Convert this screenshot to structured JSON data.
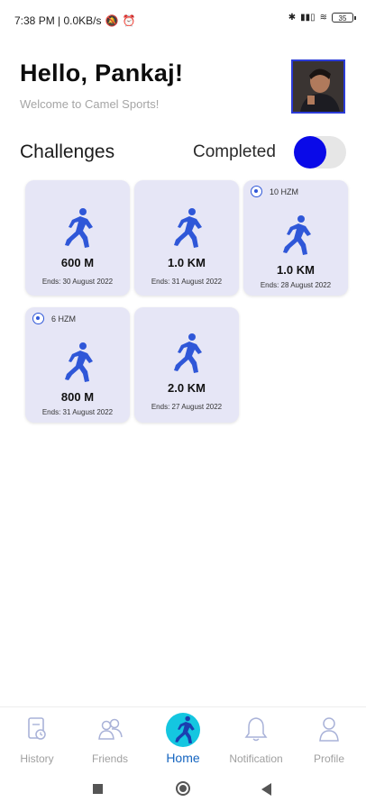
{
  "status_bar": {
    "time_net": "7:38 PM | 0.0KB/s",
    "battery": "35"
  },
  "header": {
    "greeting": "Hello, Pankaj!",
    "welcome": "Welcome to Camel Sports!"
  },
  "challenges": {
    "title": "Challenges",
    "completed_label": "Completed",
    "completed_toggle_on": false,
    "cards": [
      {
        "badge": "",
        "distance": "600 M",
        "ends": "Ends: 30 August 2022"
      },
      {
        "badge": "",
        "distance": "1.0 KM",
        "ends": "Ends: 31 August 2022"
      },
      {
        "badge": "10 HZM",
        "distance": "1.0 KM",
        "ends": "Ends: 28 August 2022"
      },
      {
        "badge": "6 HZM",
        "distance": "800 M",
        "ends": "Ends: 31 August 2022"
      },
      {
        "badge": "",
        "distance": "2.0 KM",
        "ends": "Ends: 27 August 2022"
      }
    ]
  },
  "nav": {
    "items": [
      {
        "label": "History",
        "icon": "history-icon"
      },
      {
        "label": "Friends",
        "icon": "friends-icon"
      },
      {
        "label": "Home",
        "icon": "runner-icon"
      },
      {
        "label": "Notification",
        "icon": "bell-icon"
      },
      {
        "label": "Profile",
        "icon": "person-icon"
      }
    ],
    "active": "Home"
  },
  "colors": {
    "accent": "#0a0ae8",
    "card_bg": "#e6e6f6",
    "runner": "#2f57d8",
    "home_circle": "#14c6e0"
  }
}
